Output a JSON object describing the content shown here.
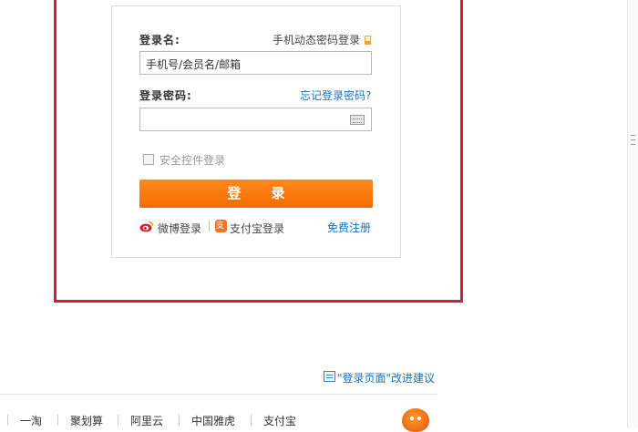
{
  "login": {
    "username_label": "登录名:",
    "sms_login_link": "手机动态密码登录",
    "username_placeholder": "手机号/会员名/邮箱",
    "password_label": "登录密码:",
    "forgot_password_link": "忘记登录密码?",
    "security_control_label": "安全控件登录",
    "login_button_label": "登 录",
    "weibo_login_label": "微博登录",
    "alipay_login_label": "支付宝登录",
    "register_link": "免费注册"
  },
  "feedback": {
    "label": "\"登录页面\"改进建议"
  },
  "footer": {
    "links": [
      "一淘",
      "聚划算",
      "阿里云",
      "中国雅虎",
      "支付宝"
    ]
  },
  "colors": {
    "highlight_border": "#d8202c",
    "login_button": "#f56a00",
    "link_blue": "#1a6fb7"
  },
  "icons": [
    "phone-icon",
    "keyboard-icon",
    "weibo-icon",
    "alipay-icon",
    "feedback-icon",
    "mascot-icon",
    "scroll-grip-icon"
  ]
}
